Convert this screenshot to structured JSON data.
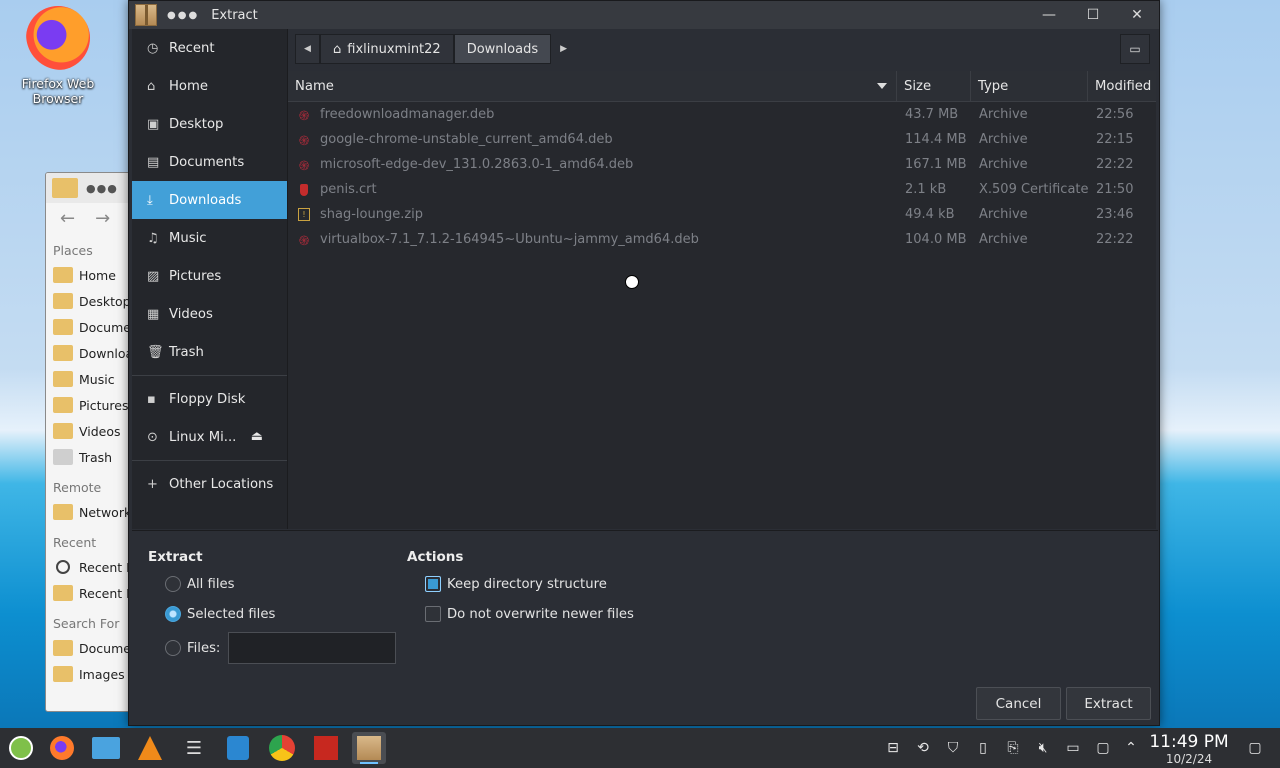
{
  "desktop": {
    "icon_label": "Firefox Web Browser"
  },
  "background_fm": {
    "places_header": "Places",
    "places": [
      "Home",
      "Desktop",
      "Docume",
      "Downloa",
      "Music",
      "Pictures",
      "Videos",
      "Trash"
    ],
    "remote_header": "Remote",
    "remote": [
      "Network"
    ],
    "recent_header": "Recent",
    "recent": [
      "Recent F",
      "Recent L"
    ],
    "search_header": "Search For",
    "search": [
      "Docume",
      "Images"
    ]
  },
  "dialog": {
    "title": "Extract",
    "sidebar": {
      "items": [
        {
          "label": "Recent",
          "icon": "clock-icon"
        },
        {
          "label": "Home",
          "icon": "home-icon"
        },
        {
          "label": "Desktop",
          "icon": "desktop-icon"
        },
        {
          "label": "Documents",
          "icon": "documents-icon"
        },
        {
          "label": "Downloads",
          "icon": "downloads-icon"
        },
        {
          "label": "Music",
          "icon": "music-icon"
        },
        {
          "label": "Pictures",
          "icon": "pictures-icon"
        },
        {
          "label": "Videos",
          "icon": "videos-icon"
        },
        {
          "label": "Trash",
          "icon": "trash-icon"
        }
      ],
      "devices": [
        {
          "label": "Floppy Disk",
          "icon": "floppy-icon"
        },
        {
          "label": "Linux Mi...",
          "icon": "disc-icon"
        }
      ],
      "other": {
        "label": "Other Locations",
        "icon": "plus-icon"
      },
      "active": "Downloads"
    },
    "pathbar": {
      "crumbs": [
        "fixlinuxmint22",
        "Downloads"
      ]
    },
    "columns": {
      "name": "Name",
      "size": "Size",
      "type": "Type",
      "modified": "Modified"
    },
    "files": [
      {
        "name": "freedownloadmanager.deb",
        "size": "43.7 MB",
        "type": "Archive",
        "modified": "22:56",
        "icon": "deb"
      },
      {
        "name": "google-chrome-unstable_current_amd64.deb",
        "size": "114.4 MB",
        "type": "Archive",
        "modified": "22:15",
        "icon": "deb"
      },
      {
        "name": "microsoft-edge-dev_131.0.2863.0-1_amd64.deb",
        "size": "167.1 MB",
        "type": "Archive",
        "modified": "22:22",
        "icon": "deb"
      },
      {
        "name": "penis.crt",
        "size": "2.1 kB",
        "type": "X.509 Certificate",
        "modified": "21:50",
        "icon": "crt"
      },
      {
        "name": "shag-lounge.zip",
        "size": "49.4 kB",
        "type": "Archive",
        "modified": "23:46",
        "icon": "zip"
      },
      {
        "name": "virtualbox-7.1_7.1.2-164945~Ubuntu~jammy_amd64.deb",
        "size": "104.0 MB",
        "type": "Archive",
        "modified": "22:22",
        "icon": "deb"
      }
    ],
    "extract": {
      "title": "Extract",
      "all_files": "All files",
      "selected_files": "Selected files",
      "files": "Files:",
      "files_value": "",
      "selected": "selected_files"
    },
    "actions": {
      "title": "Actions",
      "keep_structure": "Keep directory structure",
      "keep_structure_checked": true,
      "no_overwrite": "Do not overwrite newer files",
      "no_overwrite_checked": false
    },
    "buttons": {
      "cancel": "Cancel",
      "extract": "Extract"
    }
  },
  "taskbar": {
    "time": "11:49 PM",
    "date": "10/2/24"
  }
}
